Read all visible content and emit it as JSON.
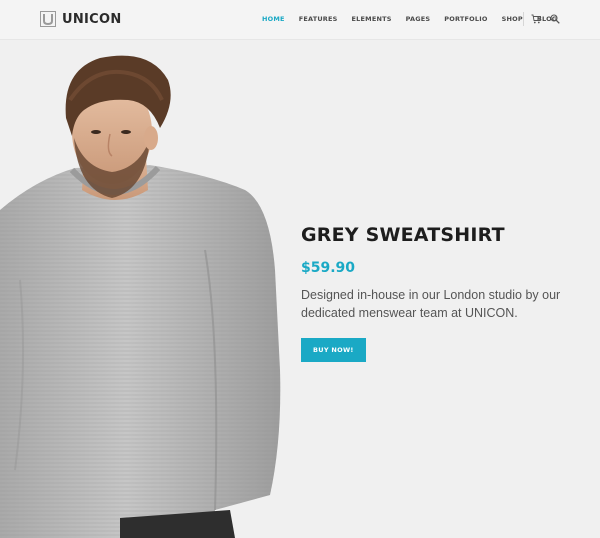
{
  "brand": {
    "name": "UNICON",
    "accent": "#1aa9c5"
  },
  "nav": {
    "items": [
      {
        "label": "HOME",
        "active": true
      },
      {
        "label": "FEATURES",
        "active": false
      },
      {
        "label": "ELEMENTS",
        "active": false
      },
      {
        "label": "PAGES",
        "active": false
      },
      {
        "label": "PORTFOLIO",
        "active": false
      },
      {
        "label": "SHOP",
        "active": false
      },
      {
        "label": "BLOG",
        "active": false
      }
    ],
    "icons": [
      "cart-icon",
      "search-icon"
    ]
  },
  "hero": {
    "image": "man-in-grey-sweatshirt-photo"
  },
  "product": {
    "title": "GREY SWEATSHIRT",
    "price": "$59.90",
    "description_line1": "Designed in-house in our London studio by our",
    "description_line2": "dedicated menswear team at UNICON.",
    "button_label": "BUY NOW!"
  }
}
